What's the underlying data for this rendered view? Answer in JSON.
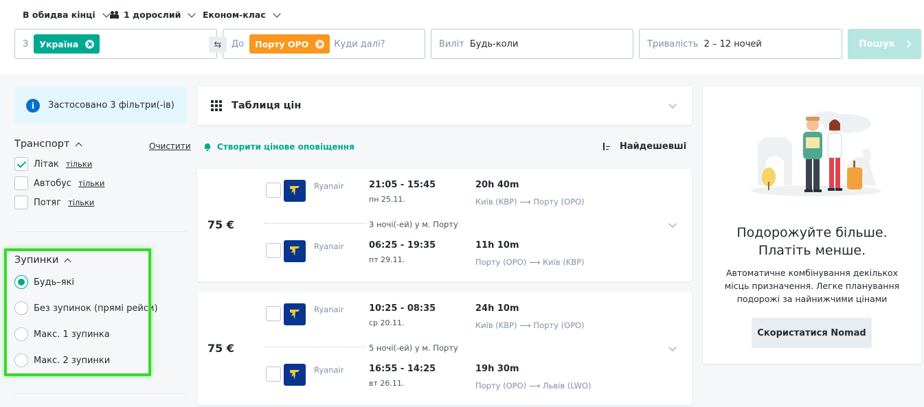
{
  "top_options": {
    "trip_type": "В обидва кінці",
    "passengers": "1 дорослий",
    "cabin_class": "Економ-клас"
  },
  "search": {
    "from_label": "З",
    "from_chip": "Україна",
    "to_label": "До",
    "to_chip": "Порту OPO",
    "to_placeholder": "Куди далі?",
    "departure_label": "Виліт",
    "departure_value": "Будь-коли",
    "duration_label": "Тривалість",
    "duration_value": "2 – 12 ночей",
    "search_button": "Пошук"
  },
  "colors": {
    "accent": "#00a991",
    "orange": "#f9971e",
    "info_bg": "#e5f7fe",
    "highlight": "#36d92a"
  },
  "filters": {
    "applied_text": "Застосовано 3 фільтри(-ів)",
    "transport_title": "Транспорт",
    "clear_label": "Очистити",
    "only_label": "тільки",
    "transport": [
      {
        "label": "Літак",
        "checked": true
      },
      {
        "label": "Автобус",
        "checked": false
      },
      {
        "label": "Потяг",
        "checked": false
      }
    ],
    "stops_title": "Зупинки",
    "stops": [
      {
        "label": "Будь–які",
        "selected": true
      },
      {
        "label": "Без зупинок (прямі рейси)",
        "selected": false
      },
      {
        "label": "Макс. 1 зупинка",
        "selected": false
      },
      {
        "label": "Макс. 2 зупинки",
        "selected": false
      }
    ]
  },
  "results": {
    "price_table": "Таблиця цін",
    "price_alert": "Створити цінове оповіщення",
    "sort": "Найдешевші",
    "cards": [
      {
        "price": "75 €",
        "nights": "3 ночі(-ей) у м. Порту",
        "legs": [
          {
            "airline": "Ryanair",
            "times": "21:05 - 15:45",
            "date": "пн 25.11.",
            "duration": "20h 40m",
            "route_from": "Київ (KBP)",
            "route_to": "Порту (OPO)"
          },
          {
            "airline": "Ryanair",
            "times": "06:25 - 19:35",
            "date": "пт 29.11.",
            "duration": "11h 10m",
            "route_from": "Порту (OPO)",
            "route_to": "Київ (KBP)"
          }
        ]
      },
      {
        "price": "75 €",
        "nights": "5 ночі(-ей) у м. Порту",
        "legs": [
          {
            "airline": "Ryanair",
            "times": "10:25 - 08:35",
            "date": "ср 20.11.",
            "duration": "24h 10m",
            "route_from": "Київ (KBP)",
            "route_to": "Порту (OPO)"
          },
          {
            "airline": "Ryanair",
            "times": "16:55 - 14:25",
            "date": "вт 26.11.",
            "duration": "19h 30m",
            "route_from": "Порту (OPO)",
            "route_to": "Львів (LWO)"
          }
        ]
      }
    ]
  },
  "promo": {
    "title_line1": "Подорожуйте більше.",
    "title_line2": "Платіть менше.",
    "text": "Автоматичне комбінування декількох місць призначення. Легке планування подорожі за найнижчими цінами",
    "button": "Скористатися Nomad"
  }
}
